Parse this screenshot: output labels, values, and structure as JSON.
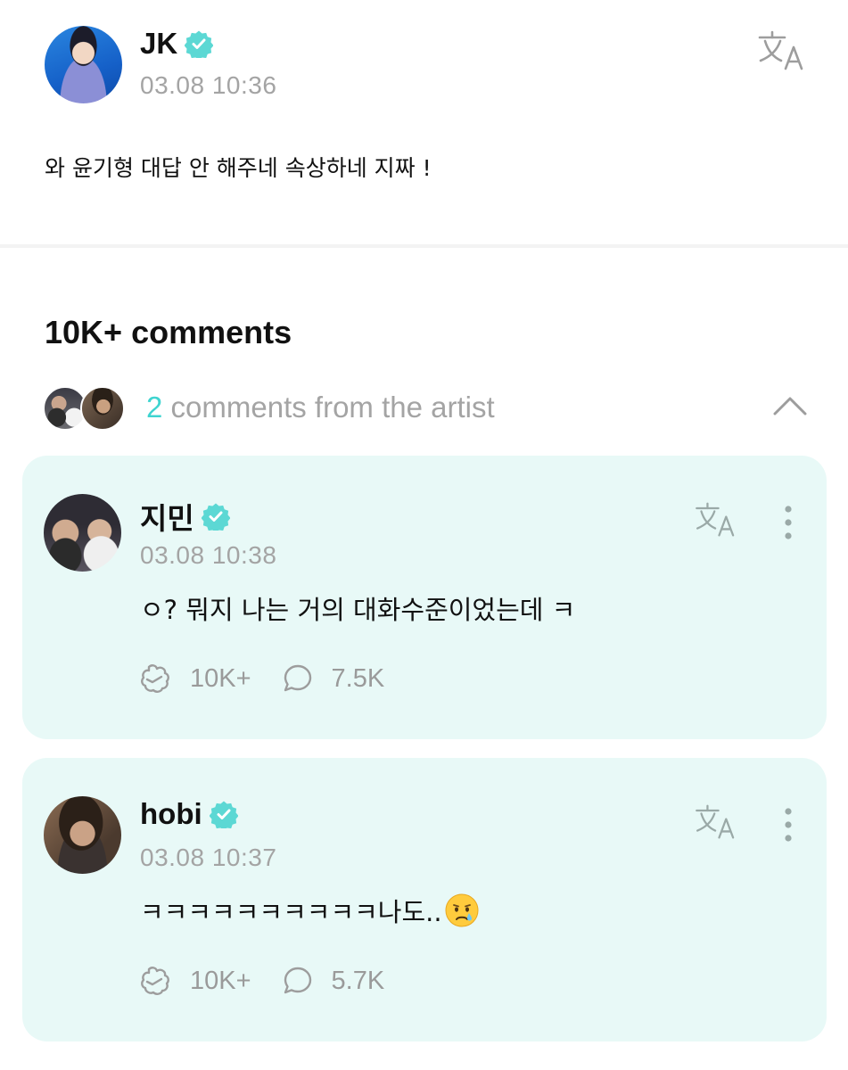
{
  "post": {
    "author": "JK",
    "verified": true,
    "timestamp": "03.08 10:36",
    "text": "와 윤기형 대답 안 해주네 속상하네 지짜 !"
  },
  "comments_section": {
    "title": "10K+ comments",
    "artist_comments_count": "2",
    "artist_comments_label": "comments from the artist"
  },
  "comments": [
    {
      "author": "지민",
      "verified": true,
      "timestamp": "03.08 10:38",
      "text": "ㅇ?  뭐지 나는 거의 대화수준이었는데 ㅋ",
      "likes": "10K+",
      "replies": "7.5K"
    },
    {
      "author": "hobi",
      "verified": true,
      "timestamp": "03.08 10:37",
      "text": "ㅋㅋㅋㅋㅋㅋㅋㅋㅋㅋ나도..",
      "emoji": "crying-face",
      "likes": "10K+",
      "replies": "5.7K"
    }
  ],
  "icons": {
    "verified": "verified-badge-icon",
    "translate": "translate-icon",
    "collapse": "chevron-up-icon",
    "more": "more-vertical-icon",
    "like": "like-icon",
    "reply": "comment-bubble-icon"
  },
  "colors": {
    "accent": "#3fd4d0",
    "card_background": "#e8f9f7",
    "secondary_text": "#a4a4a4"
  }
}
